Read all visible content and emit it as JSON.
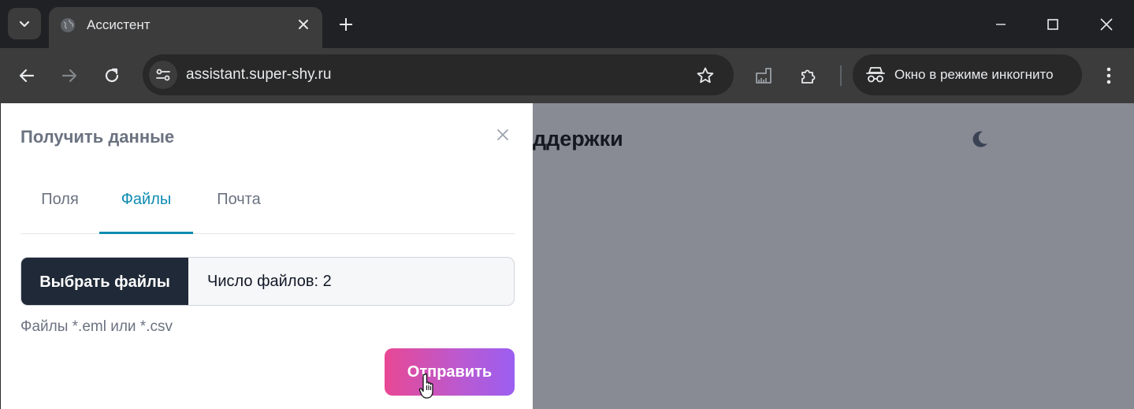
{
  "browser": {
    "tab_title": "Ассистент",
    "url": "assistant.super-shy.ru",
    "incognito_label": "Окно в режиме инкогнито"
  },
  "page": {
    "background_heading": "ддержки"
  },
  "drawer": {
    "title": "Получить данные",
    "tabs": [
      {
        "label": "Поля",
        "active": false
      },
      {
        "label": "Файлы",
        "active": true
      },
      {
        "label": "Почта",
        "active": false
      }
    ],
    "file_button_label": "Выбрать файлы",
    "file_count_text": "Число файлов: 2",
    "hint": "Файлы *.eml или *.csv",
    "submit_label": "Отправить"
  },
  "colors": {
    "accent": "#0e8bb1",
    "file_button_bg": "#1f2937",
    "submit_gradient_start": "#e84894",
    "submit_gradient_end": "#9b5ef0",
    "overlay": "#888b94"
  },
  "icons": {
    "tab_search": "chevron-down-icon",
    "favicon": "globe-icon",
    "tab_close": "close-icon",
    "new_tab": "plus-icon",
    "minimize": "minimize-icon",
    "maximize": "maximize-icon",
    "window_close": "close-icon",
    "back": "arrow-left-icon",
    "forward": "arrow-right-icon",
    "reload": "reload-icon",
    "site_info": "tune-icon",
    "bookmark": "star-icon",
    "extension_1": "ruler-icon",
    "extensions": "puzzle-icon",
    "incognito": "incognito-icon",
    "menu": "more-vertical-icon",
    "theme": "moon-icon",
    "drawer_close": "close-icon",
    "cursor": "hand-pointer-icon"
  }
}
